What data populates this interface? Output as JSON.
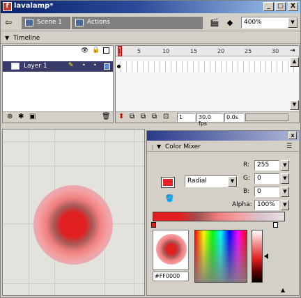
{
  "window": {
    "title": "lavalamp*",
    "min": "_",
    "max": "□",
    "close": "X"
  },
  "scene": {
    "back": "⇦",
    "scene_label": "Scene 1",
    "actions_label": "Actions",
    "zoom": "400%"
  },
  "timeline": {
    "header": "Timeline",
    "layer_name": "Layer 1",
    "ruler_ticks": [
      "1",
      "5",
      "10",
      "15",
      "20",
      "25",
      "30"
    ],
    "current_frame": "1",
    "fps": "30.0 fps",
    "elapsed": "0.0s"
  },
  "mixer": {
    "title": "Color Mixer",
    "fill_type": "Radial",
    "r_label": "R:",
    "r_value": "255",
    "g_label": "G:",
    "g_value": "0",
    "b_label": "B:",
    "b_value": "0",
    "alpha_label": "Alpha:",
    "alpha_value": "100%",
    "hex": "#FF0000"
  },
  "colors": {
    "accent_red": "#e8202a",
    "titlebar": "#0a246a"
  }
}
